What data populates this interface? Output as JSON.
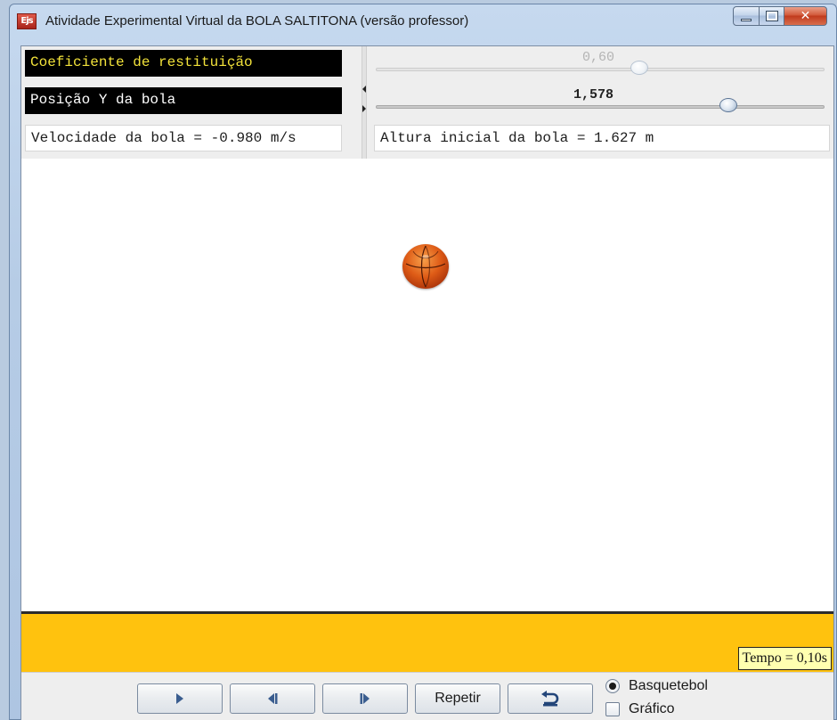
{
  "window": {
    "title": "Atividade Experimental Virtual da BOLA SALTITONA (versão professor)",
    "app_icon_text": "Ejs"
  },
  "controls": {
    "restitution_label": "Coeficiente de restituição",
    "restitution_slider": {
      "value_text": "0,60",
      "value": 0.6,
      "enabled": false
    },
    "position_label": "Posição Y da bola",
    "position_slider": {
      "value_text": "1,578",
      "value": 1.578,
      "enabled": true
    },
    "velocity_text": "Velocidade da bola = -0.980 m/s",
    "initial_height_text": "Altura inicial da bola = 1.627 m"
  },
  "simulation": {
    "ball_icon": "basketball-icon",
    "tempo_text": "Tempo = 0,10s",
    "floor_color": "#ffc20e"
  },
  "toolbar": {
    "play_icon": "play-icon",
    "step_back_icon": "step-back-icon",
    "step_forward_icon": "step-forward-icon",
    "repeat_label": "Repetir",
    "reset_icon": "undo-icon",
    "options": [
      {
        "label": "Basquetebol",
        "type": "radio",
        "checked": true
      },
      {
        "label": "Gráfico",
        "type": "checkbox",
        "checked": false
      }
    ]
  },
  "colors": {
    "label_dark_bg": "#000000",
    "label_yellow_text": "#f2e23a",
    "floor": "#ffc20e",
    "tempo_bg": "#ffffb0"
  }
}
